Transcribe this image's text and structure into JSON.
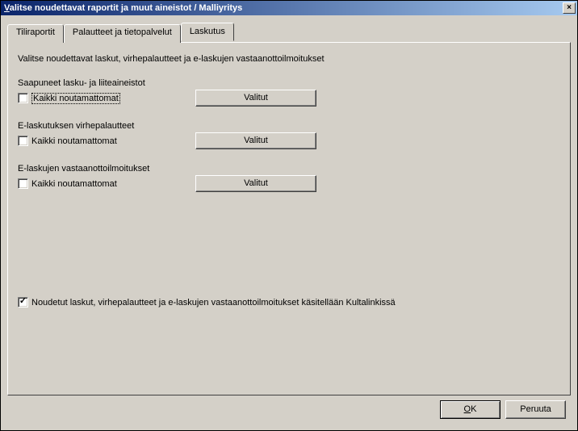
{
  "titlebar": {
    "title": "Valitse noudettavat raportit ja muut aineistot / Malliyritys",
    "close": "×"
  },
  "tabs": {
    "tiliraportit": "Tiliraportit",
    "palautteet": "Palautteet ja tietopalvelut",
    "laskutus": "Laskutus"
  },
  "panel": {
    "instruction": "Valitse noudettavat laskut, virhepalautteet ja e-laskujen vastaanottoilmoitukset",
    "section1": {
      "label": "Saapuneet lasku- ja liiteaineistot",
      "checkbox": "Kaikki noutamattomat",
      "button": "Valitut"
    },
    "section2": {
      "label": "E-laskutuksen virhepalautteet",
      "checkbox": "Kaikki noutamattomat",
      "button": "Valitut"
    },
    "section3": {
      "label": "E-laskujen vastaanottoilmoitukset",
      "checkbox": "Kaikki noutamattomat",
      "button": "Valitut"
    },
    "processCheckbox": "Noudetut laskut, virhepalautteet ja e-laskujen vastaanottoilmoitukset käsitellään Kultalinkissä"
  },
  "buttons": {
    "ok": "OK",
    "cancel": "Peruuta"
  }
}
